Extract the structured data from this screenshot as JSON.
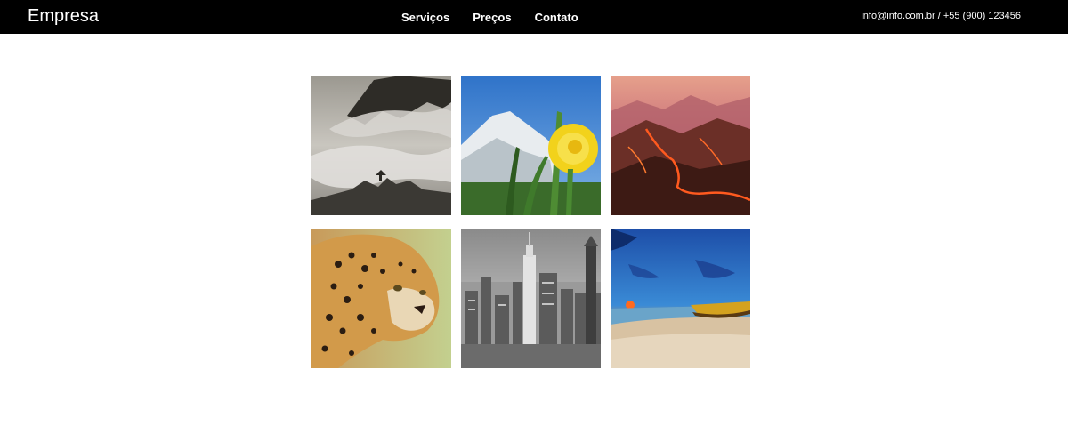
{
  "header": {
    "brand": "Empresa",
    "nav": [
      {
        "label": "Serviços"
      },
      {
        "label": "Preços"
      },
      {
        "label": "Contato"
      }
    ],
    "contact": "info@info.com.br / +55 (900) 123456"
  },
  "colors": {
    "header_background": "#000000",
    "header_text": "#ffffff",
    "page_background": "#ffffff"
  },
  "gallery": {
    "images": [
      {
        "subject": "misty-mountains"
      },
      {
        "subject": "dandelion-snowy-peak"
      },
      {
        "subject": "volcanic-landscape"
      },
      {
        "subject": "leopard"
      },
      {
        "subject": "city-skyline"
      },
      {
        "subject": "beach-sunset-boat"
      }
    ]
  }
}
